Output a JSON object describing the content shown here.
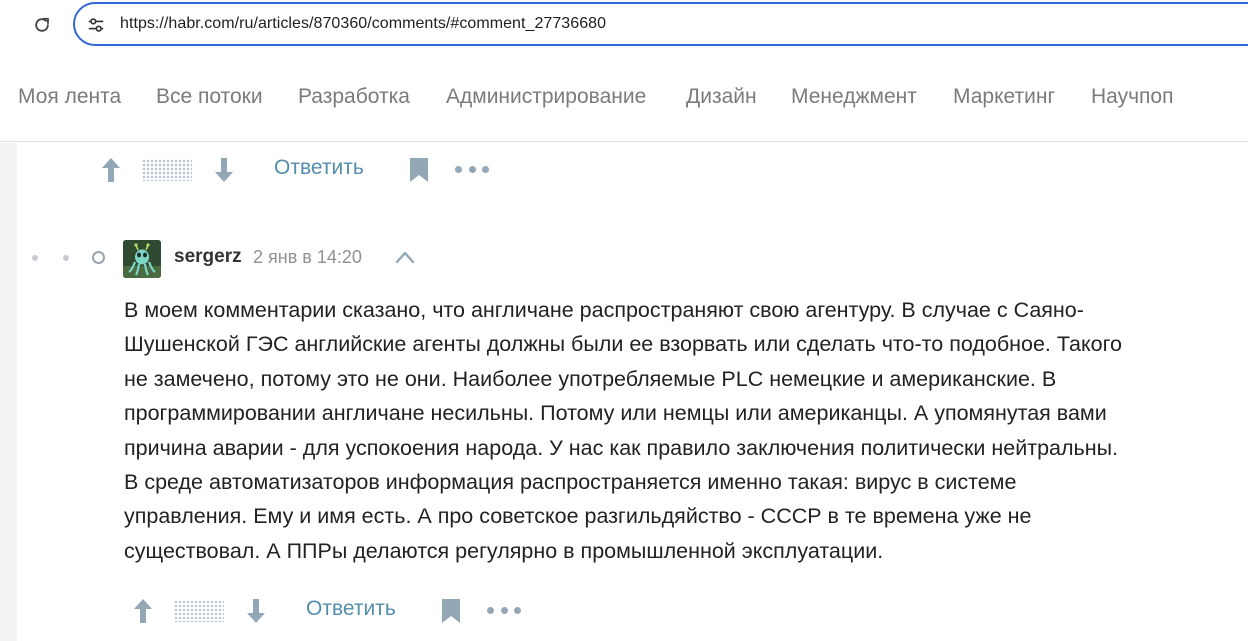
{
  "browser": {
    "url": "https://habr.com/ru/articles/870360/comments/#comment_27736680"
  },
  "nav": {
    "items": [
      {
        "label": "Моя лента"
      },
      {
        "label": "Все потоки"
      },
      {
        "label": "Разработка"
      },
      {
        "label": "Администрирование"
      },
      {
        "label": "Дизайн"
      },
      {
        "label": "Менеджмент"
      },
      {
        "label": "Маркетинг"
      },
      {
        "label": "Научпоп"
      }
    ]
  },
  "prev_comment_actions": {
    "reply_label": "Ответить"
  },
  "comment": {
    "author": "sergerz",
    "timestamp": "2 янв в 14:20",
    "lines": [
      "В моем комментарии сказано, что англичане распространяют свою агентуру. В случае с Саяно-",
      "Шушенской ГЭС английские агенты должны были ее взорвать или сделать что-то подобное. Такого",
      "не замечено, потому это не они. Наиболее употребляемые PLC немецкие и американские. В",
      "программировании англичане несильны. Потому или немцы или американцы. А упомянутая вами",
      "причина аварии - для успокоения народа. У нас как правило заключения политически нейтральны.",
      "В среде автоматизаторов информация распространяется именно такая: вирус в системе",
      "управления. Ему и имя есть. А про советское разгильдяйство - СССР в те времена уже не",
      "существовал. А ППРы делаются регулярно в промышленной эксплуатации."
    ],
    "reply_label": "Ответить"
  },
  "icons": {
    "reload": "reload-icon",
    "site_settings": "tune-icon",
    "vote_up": "arrow-up-icon",
    "vote_down": "arrow-down-icon",
    "bookmark": "bookmark-icon",
    "more": "more-dots-icon",
    "collapse": "chevron-up-icon"
  },
  "colors": {
    "address_border": "#3467d6",
    "nav_text": "#7b7b7b",
    "link": "#548eaa",
    "icon": "#93a8b7",
    "content_bg": "#f2f3f5"
  }
}
